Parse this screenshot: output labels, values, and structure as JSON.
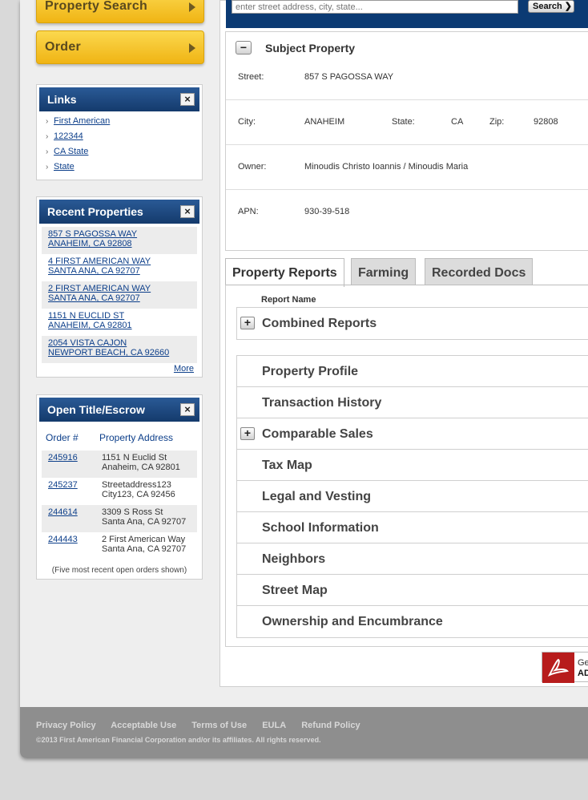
{
  "nav": {
    "property_search": "Property Search",
    "order": "Order"
  },
  "search": {
    "placeholder": "enter street address, city, state...",
    "button": "Search ❯"
  },
  "links_box": {
    "title": "Links",
    "close": "×",
    "items": [
      "First American",
      "122344",
      "CA State",
      "State"
    ]
  },
  "recent_box": {
    "title": "Recent Properties",
    "close": "×",
    "items": [
      {
        "line1": "857 S PAGOSSA WAY",
        "line2": "ANAHEIM, CA 92808"
      },
      {
        "line1": "4 FIRST AMERICAN WAY",
        "line2": "SANTA ANA, CA 92707"
      },
      {
        "line1": "2 FIRST AMERICAN WAY",
        "line2": "SANTA ANA, CA 92707"
      },
      {
        "line1": "1151 N EUCLID ST",
        "line2": "ANAHEIM, CA 92801"
      },
      {
        "line1": "2054 VISTA CAJON",
        "line2": "NEWPORT BEACH, CA 92660"
      }
    ],
    "more": "More"
  },
  "open_title_box": {
    "title": "Open Title/Escrow",
    "close": "×",
    "col_order": "Order #",
    "col_address": "Property Address",
    "rows": [
      {
        "order": "245916",
        "addr1": "1151 N Euclid St",
        "addr2": "Anaheim, CA 92801"
      },
      {
        "order": "245237",
        "addr1": "Streetaddress123",
        "addr2": "City123, CA 92456"
      },
      {
        "order": "244614",
        "addr1": "3309 S Ross St",
        "addr2": "Santa Ana, CA 92707"
      },
      {
        "order": "244443",
        "addr1": "2 First American Way",
        "addr2": "Santa Ana, CA 92707"
      }
    ],
    "note": "(Five most recent open orders shown)"
  },
  "subject": {
    "toggle": "−",
    "title": "Subject Property",
    "street_label": "Street:",
    "street": "857 S PAGOSSA WAY",
    "city_label": "City:",
    "city": "ANAHEIM",
    "state_label": "State:",
    "state": "CA",
    "zip_label": "Zip:",
    "zip": "92808",
    "owner_label": "Owner:",
    "owner": "Minoudis Christo Ioannis / Minoudis Maria",
    "apn_label": "APN:",
    "apn": "930-39-518"
  },
  "tabs": [
    "Property Reports",
    "Farming",
    "Recorded Docs"
  ],
  "reports": {
    "column_label": "Report Name",
    "expand": "+",
    "combined": "Combined Reports",
    "items": [
      {
        "label": "Property Profile",
        "expandable": false
      },
      {
        "label": "Transaction History",
        "expandable": false
      },
      {
        "label": "Comparable Sales",
        "expandable": true
      },
      {
        "label": "Tax Map",
        "expandable": false
      },
      {
        "label": "Legal and Vesting",
        "expandable": false
      },
      {
        "label": "School Information",
        "expandable": false
      },
      {
        "label": "Neighbors",
        "expandable": false
      },
      {
        "label": "Street Map",
        "expandable": false
      },
      {
        "label": "Ownership and Encumbrance",
        "expandable": false
      }
    ]
  },
  "adobe": {
    "line1": "Ge",
    "line2": "AD"
  },
  "footer": {
    "links": [
      "Privacy Policy",
      "Acceptable Use",
      "Terms of Use",
      "EULA",
      "Refund Policy"
    ],
    "copyright": "©2013 First American Financial Corporation and/or its affiliates. All rights reserved."
  }
}
